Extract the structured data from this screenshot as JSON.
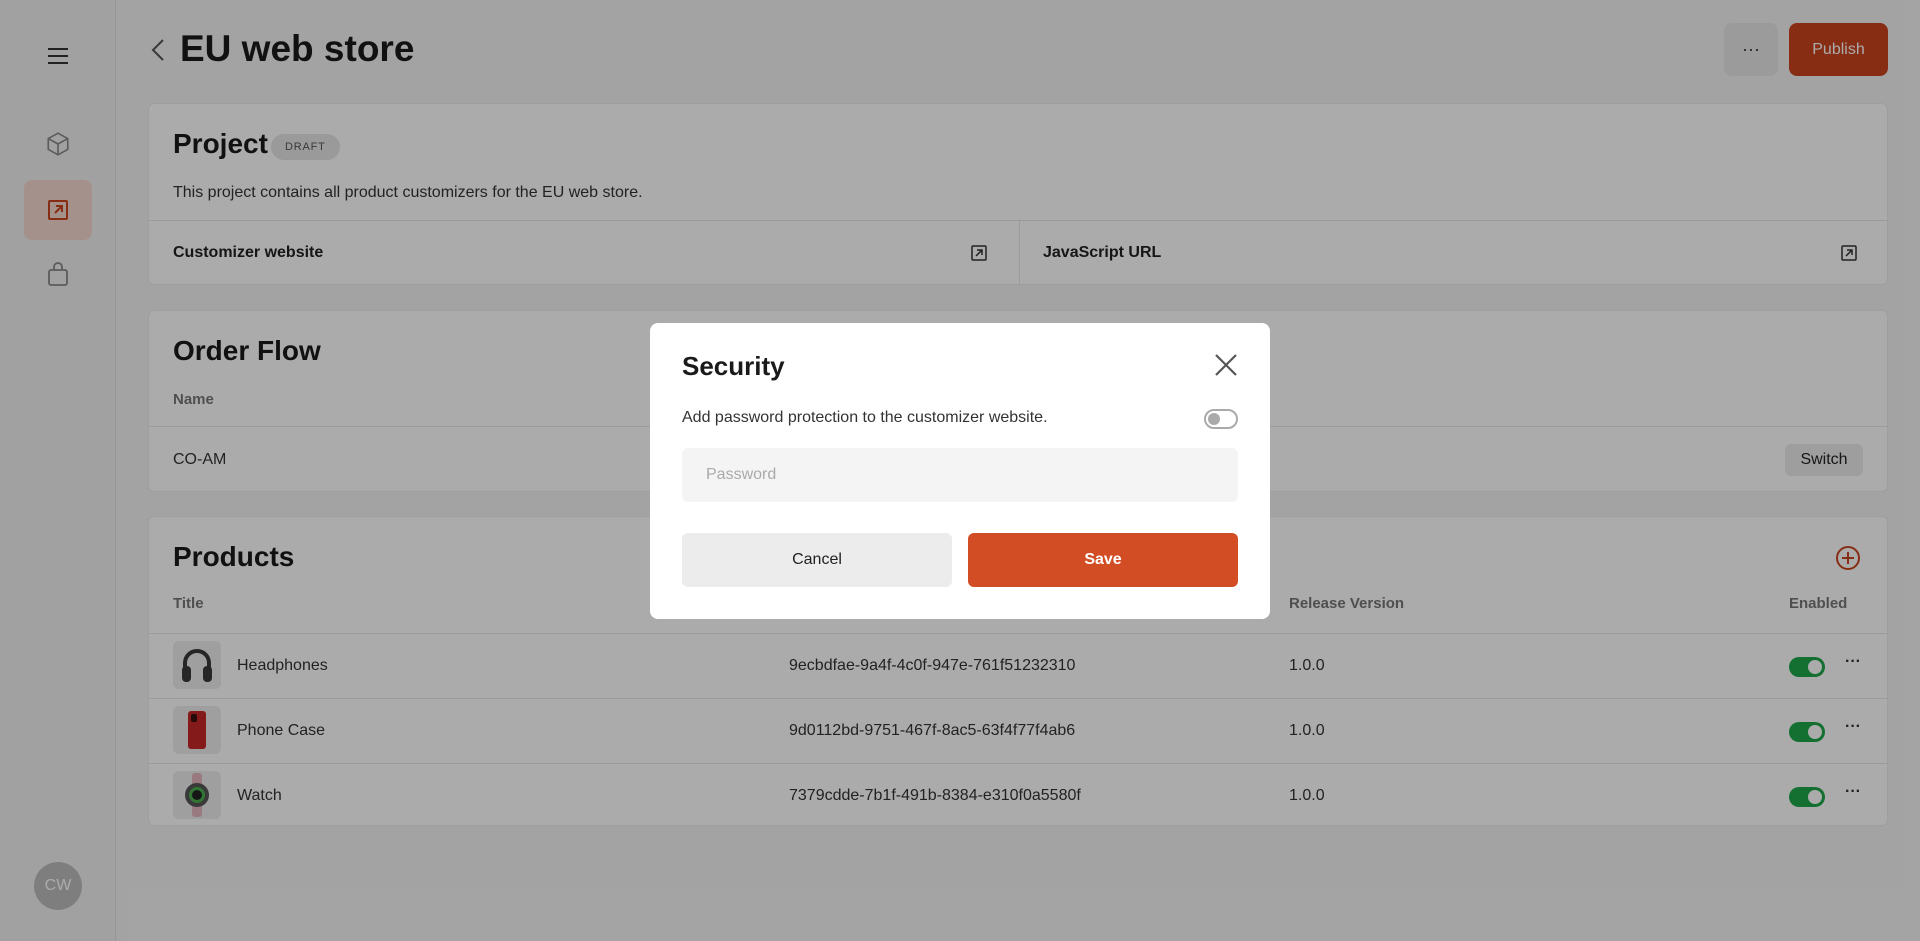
{
  "sidebar": {
    "avatar_initials": "CW",
    "items": [
      {
        "icon": "menu-icon"
      },
      {
        "icon": "cube-icon"
      },
      {
        "icon": "external-link-icon",
        "active": true
      },
      {
        "icon": "shopping-bag-icon"
      }
    ]
  },
  "header": {
    "title": "EU web store",
    "more_label": "···",
    "publish_label": "Publish"
  },
  "project": {
    "title": "Project",
    "badge": "DRAFT",
    "description": "This project contains all product customizers for the EU web store.",
    "links": [
      "Customizer website",
      "JavaScript URL"
    ]
  },
  "order_flow": {
    "title": "Order Flow",
    "column_name": "Name",
    "row_name": "CO-AM",
    "switch_label": "Switch"
  },
  "products": {
    "title": "Products",
    "columns": [
      "Title",
      "Release Version",
      "Enabled"
    ],
    "rows": [
      {
        "title": "Headphones",
        "id": "9ecbdfae-9a4f-4c0f-947e-761f51232310",
        "version": "1.0.0",
        "enabled": true
      },
      {
        "title": "Phone Case",
        "id": "9d0112bd-9751-467f-8ac5-63f4f77f4ab6",
        "version": "1.0.0",
        "enabled": true
      },
      {
        "title": "Watch",
        "id": "7379cdde-7b1f-491b-8384-e310f0a5580f",
        "version": "1.0.0",
        "enabled": true
      }
    ],
    "row_more_label": "···"
  },
  "modal": {
    "title": "Security",
    "description": "Add password protection to the customizer website.",
    "password_enabled": false,
    "password_placeholder": "Password",
    "cancel_label": "Cancel",
    "save_label": "Save"
  },
  "colors": {
    "accent": "#d24d23",
    "toggle_on": "#1fa84a"
  }
}
